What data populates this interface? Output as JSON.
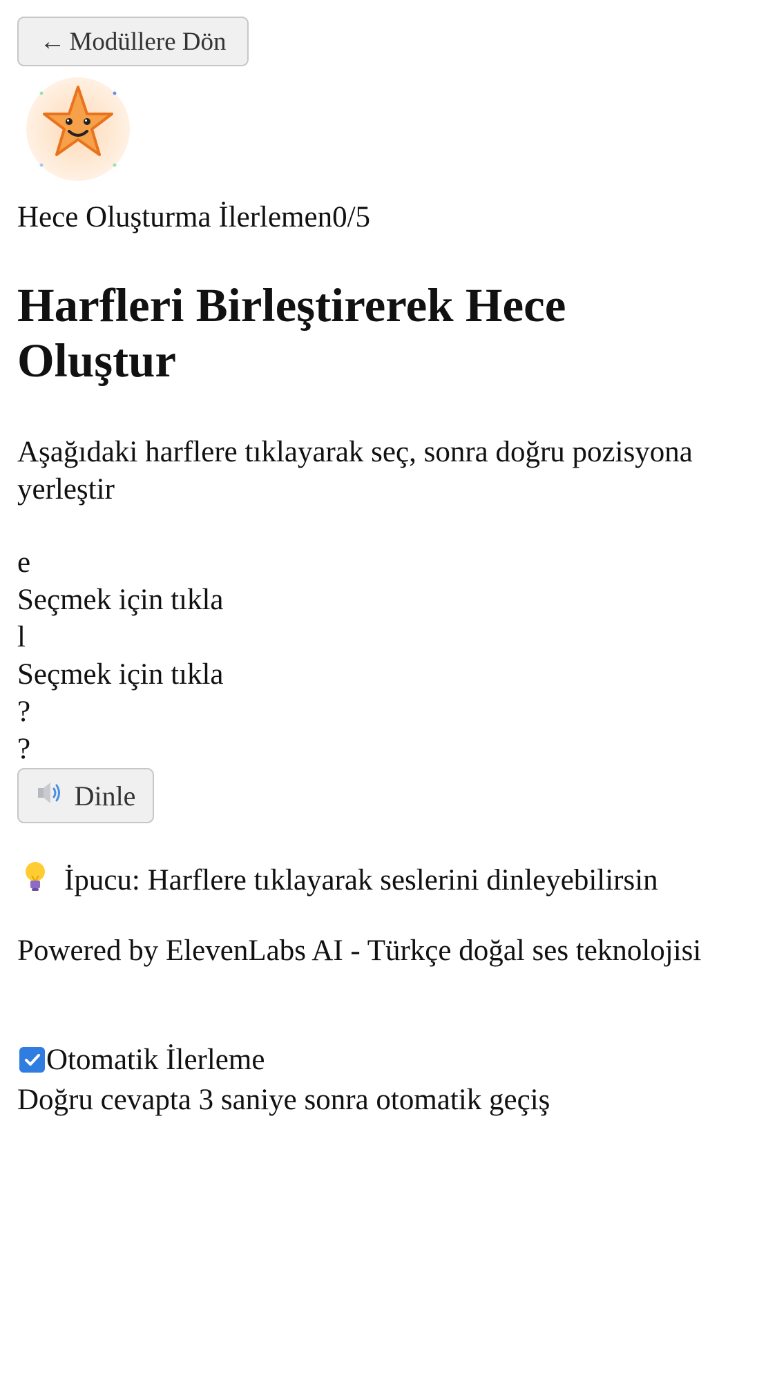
{
  "nav": {
    "back_arrow": "←",
    "back_label": "Modüllere Dön"
  },
  "mascot": {
    "icon": "smiling-star-icon",
    "color": "#f7a04a"
  },
  "progress": {
    "label": "Hece Oluşturma İlerlemen",
    "current": 0,
    "total": 5,
    "text": "0/5"
  },
  "exercise": {
    "title": "Harfleri Birleştirerek Hece Oluştur",
    "instruction": "Aşağıdaki harflere tıklayarak seç, sonra doğru pozisyona yerleştir",
    "letters": [
      {
        "letter": "e",
        "hint": "Seçmek için tıkla"
      },
      {
        "letter": "l",
        "hint": "Seçmek için tıkla"
      }
    ],
    "slots": [
      "?",
      "?"
    ],
    "listen_button": {
      "icon": "speaker-icon",
      "label": "Dinle"
    }
  },
  "tip": {
    "icon": "light-bulb-icon",
    "text": "İpucu: Harflere tıklayarak seslerini dinleyebilirsin"
  },
  "footer": {
    "powered_by": "Powered by ElevenLabs AI - Türkçe doğal ses teknolojisi"
  },
  "settings": {
    "auto_advance_label": "Otomatik İlerleme",
    "auto_advance_checked": true,
    "auto_advance_description": "Doğru cevapta 3 saniye sonra otomatik geçiş"
  },
  "colors": {
    "accent": "#2f7de1",
    "button_bg": "#f0f0f0",
    "button_border": "#c7c7c7",
    "star": "#f7a04a"
  }
}
